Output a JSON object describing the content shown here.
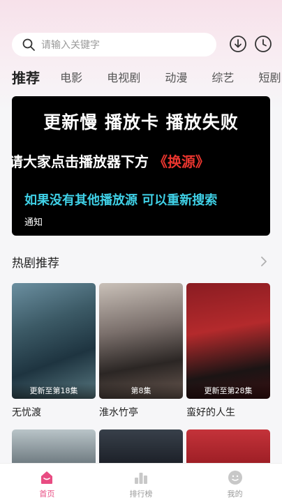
{
  "search": {
    "placeholder": "请输入关键字"
  },
  "top_icons": [
    "download-icon",
    "history-clock-icon"
  ],
  "tabs": [
    {
      "label": "推荐",
      "active": true
    },
    {
      "label": "电影"
    },
    {
      "label": "电视剧"
    },
    {
      "label": "动漫"
    },
    {
      "label": "综艺"
    },
    {
      "label": "短剧"
    }
  ],
  "banner": {
    "line1": "更新慢 播放卡 播放失败",
    "line2_prefix": "请大家点击播放器下方 ",
    "line2_highlight": "《换源》",
    "line3": "如果没有其他播放源 可以重新搜索",
    "label": "通知"
  },
  "section": {
    "title": "热剧推荐"
  },
  "cards": [
    {
      "name": "无忧渡",
      "episode": "更新至第18集"
    },
    {
      "name": "淮水竹亭",
      "episode": "第8集"
    },
    {
      "name": "蛮好的人生",
      "episode": "更新至第28集"
    }
  ],
  "bottom_nav": [
    {
      "label": "首页",
      "icon": "home-icon",
      "active": true
    },
    {
      "label": "排行榜",
      "icon": "ranking-icon"
    },
    {
      "label": "我的",
      "icon": "profile-icon"
    }
  ],
  "colors": {
    "accent": "#e84c82",
    "banner_bg": "#000000",
    "banner_highlight": "#e9352e",
    "banner_cyan": "#3fd0e6"
  }
}
